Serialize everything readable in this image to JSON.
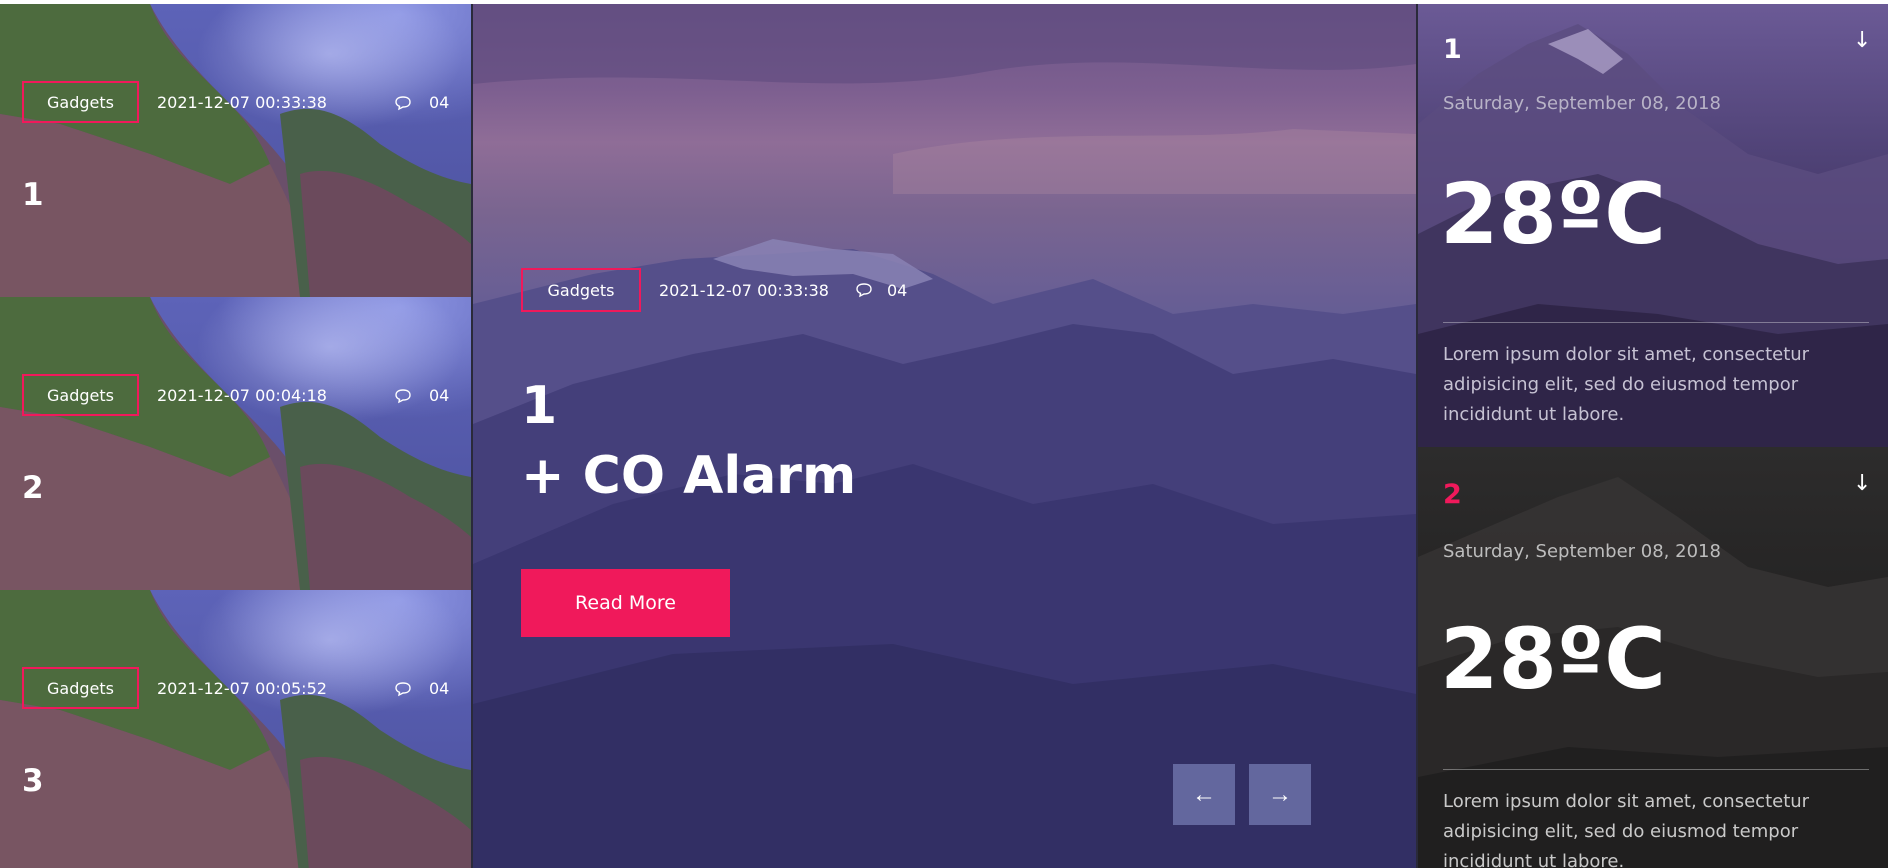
{
  "side_posts": [
    {
      "tag": "Gadgets",
      "date": "2021-12-07 00:33:38",
      "comments": "04",
      "index": "1"
    },
    {
      "tag": "Gadgets",
      "date": "2021-12-07 00:04:18",
      "comments": "04",
      "index": "2"
    },
    {
      "tag": "Gadgets",
      "date": "2021-12-07 00:05:52",
      "comments": "04",
      "index": "3"
    }
  ],
  "hero": {
    "tag": "Gadgets",
    "date": "2021-12-07 00:33:38",
    "comments": "04",
    "index": "1",
    "title": "+ CO Alarm",
    "read_more_label": "Read More",
    "prev_arrow": "←",
    "next_arrow": "→"
  },
  "weather": [
    {
      "index": "1",
      "arrow": "↓",
      "date": "Saturday, September 08, 2018",
      "temp": "28ºC",
      "description": "Lorem ipsum dolor sit amet, consectetur adipisicing elit, sed do eiusmod tempor incididunt ut labore."
    },
    {
      "index": "2",
      "arrow": "↓",
      "date": "Saturday, September 08, 2018",
      "temp": "28ºC",
      "description": "Lorem ipsum dolor sit amet, consectetur adipisicing elit, sed do eiusmod tempor incididunt ut labore."
    }
  ],
  "colors": {
    "accent": "#f0195b",
    "hero_overlay": "#4b4f92",
    "weather_active_index": "#f0195b"
  },
  "icons": {
    "comment": "comment-bubble-icon",
    "prev": "arrow-left-icon",
    "next": "arrow-right-icon",
    "expand": "arrow-down-icon"
  }
}
